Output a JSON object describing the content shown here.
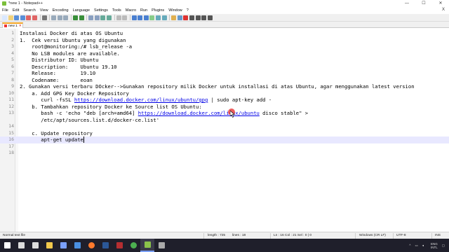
{
  "window": {
    "title": "*new 1 - Notepad++",
    "min": "—",
    "max": "☐",
    "close": "✕"
  },
  "menu": [
    "File",
    "Edit",
    "Search",
    "View",
    "Encoding",
    "Language",
    "Settings",
    "Tools",
    "Macro",
    "Run",
    "Plugins",
    "Window",
    "?"
  ],
  "menu_close": "X",
  "toolbar_icons": [
    "new-file-icon",
    "open-file-icon",
    "save-icon",
    "save-all-icon",
    "close-icon",
    "close-all-icon",
    "print-icon",
    "cut-icon",
    "copy-icon",
    "paste-icon",
    "undo-icon",
    "redo-icon",
    "find-icon",
    "replace-icon",
    "zoom-in-icon",
    "zoom-out-icon",
    "sync-v-icon",
    "sync-h-icon",
    "word-wrap-icon",
    "all-chars-icon",
    "indent-guide-icon",
    "udl-icon",
    "doc-map-icon",
    "function-list-icon",
    "folder-workspace-icon",
    "monitor-icon",
    "record-macro-icon",
    "stop-macro-icon",
    "play-macro-icon",
    "run-macro-multiple-icon",
    "save-macro-icon"
  ],
  "tab": {
    "label": "new 1",
    "close": "✕"
  },
  "lines": [
    {
      "n": "1",
      "segments": [
        {
          "t": "Instalasi Docker di atas OS Ubuntu"
        }
      ]
    },
    {
      "n": "2",
      "segments": [
        {
          "t": "1.  Cek versi Ubuntu yang digunakan"
        }
      ]
    },
    {
      "n": "3",
      "segments": [
        {
          "t": "    root@monitoring:/# lsb_release -a"
        }
      ]
    },
    {
      "n": "4",
      "segments": [
        {
          "t": "    No LSB modules are available."
        }
      ]
    },
    {
      "n": "5",
      "segments": [
        {
          "t": "    Distributor ID: Ubuntu"
        }
      ]
    },
    {
      "n": "6",
      "segments": [
        {
          "t": "    Description:    Ubuntu 19.10"
        }
      ]
    },
    {
      "n": "7",
      "segments": [
        {
          "t": "    Release:        19.10"
        }
      ]
    },
    {
      "n": "8",
      "segments": [
        {
          "t": "    Codename:       eoan"
        }
      ]
    },
    {
      "n": "9",
      "segments": [
        {
          "t": "2. Gunakan versi terbaru DOcker-->Gunakan repository milik Docker untuk installasi di atas Ubuntu, agar menggunakan latest version"
        }
      ]
    },
    {
      "n": "10",
      "segments": [
        {
          "t": "    a. Add GPG Key Docker Repository"
        }
      ]
    },
    {
      "n": "11",
      "segments": [
        {
          "t": "       curl -fsSL "
        },
        {
          "t": "https://download.docker.com/linux/ubuntu/gpg",
          "url": true
        },
        {
          "t": " | sudo apt-key add -"
        }
      ]
    },
    {
      "n": "12",
      "segments": [
        {
          "t": "    b. Tambahkan repository Docker ke Source list OS Ubuntu:"
        }
      ]
    },
    {
      "n": "13",
      "segments": [
        {
          "t": "       bash -c 'echo \"deb [arch=amd64] "
        },
        {
          "t": "https://download.docker.com/linux/ubuntu",
          "url": true
        },
        {
          "t": " disco stable\" >"
        }
      ]
    },
    {
      "n": "",
      "segments": [
        {
          "t": "       /etc/apt/sources.list.d/docker-ce.list'"
        }
      ]
    },
    {
      "n": "14",
      "segments": [
        {
          "t": ""
        }
      ]
    },
    {
      "n": "15",
      "segments": [
        {
          "t": "    c. Update repository"
        }
      ]
    },
    {
      "n": "16",
      "segments": [
        {
          "t": "       apt-get update"
        }
      ],
      "current": true
    },
    {
      "n": "17",
      "segments": [
        {
          "t": ""
        }
      ]
    },
    {
      "n": "18",
      "segments": [
        {
          "t": ""
        }
      ]
    }
  ],
  "status": {
    "file_type": "Normal text file",
    "length": "length : 725",
    "lines": "lines : 18",
    "position": "Ln : 16    Col : 21    Sel : 0 | 0",
    "eol": "Windows (CR LF)",
    "encoding": "UTF-8",
    "mode": "INS"
  },
  "taskbar": {
    "items": [
      "windows-start-icon",
      "search-icon",
      "task-view-icon",
      "file-explorer-icon",
      "store-icon",
      "mail-icon",
      "firefox-icon",
      "word-icon",
      "filezilla-icon",
      "chrome-icon",
      "notepadpp-icon",
      "terminal-icon"
    ],
    "lang": [
      "ENG",
      "INTL"
    ]
  },
  "colors": {
    "url": "#0000e6",
    "current_line": "#e8e8ff",
    "tab_accent": "#f5a623"
  }
}
